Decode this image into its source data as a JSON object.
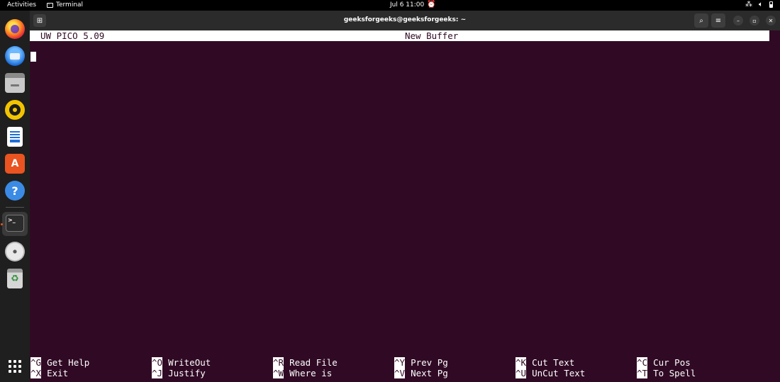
{
  "topbar": {
    "activities": "Activities",
    "app_name": "Terminal",
    "clock": "Jul 6  11:00"
  },
  "dock": {
    "items": [
      {
        "name": "Firefox",
        "icon": "firefox-icon"
      },
      {
        "name": "Thunderbird",
        "icon": "thunderbird-icon"
      },
      {
        "name": "Files",
        "icon": "files-icon"
      },
      {
        "name": "Rhythmbox",
        "icon": "rhythmbox-icon"
      },
      {
        "name": "LibreOffice Writer",
        "icon": "writer-icon"
      },
      {
        "name": "Ubuntu Software",
        "icon": "software-icon"
      },
      {
        "name": "Help",
        "icon": "help-icon",
        "glyph": "?"
      },
      {
        "name": "Terminal",
        "icon": "terminal-icon",
        "glyph": ">_"
      },
      {
        "name": "Disc",
        "icon": "disc-icon"
      },
      {
        "name": "Trash",
        "icon": "trash-icon",
        "glyph": "♻"
      },
      {
        "name": "Show Applications",
        "icon": "app-grid-icon"
      }
    ]
  },
  "window": {
    "title": "geeksforgeeks@geeksforgeeks: ~",
    "menu_glyph": "≡",
    "minimize_glyph": "–",
    "maximize_glyph": "▫",
    "close_glyph": "✕"
  },
  "pico": {
    "version": "UW PICO 5.09",
    "buffer": "New Buffer",
    "shortcuts": [
      {
        "key": "^G",
        "label": "Get Help"
      },
      {
        "key": "^X",
        "label": "Exit"
      },
      {
        "key": "^O",
        "label": "WriteOut"
      },
      {
        "key": "^J",
        "label": "Justify"
      },
      {
        "key": "^R",
        "label": "Read File"
      },
      {
        "key": "^W",
        "label": "Where is"
      },
      {
        "key": "^Y",
        "label": "Prev Pg"
      },
      {
        "key": "^V",
        "label": "Next Pg"
      },
      {
        "key": "^K",
        "label": "Cut Text"
      },
      {
        "key": "^U",
        "label": "UnCut Text"
      },
      {
        "key": "^C",
        "label": "Cur Pos"
      },
      {
        "key": "^T",
        "label": "To Spell"
      }
    ]
  },
  "colors": {
    "terminal_bg": "#300a24",
    "accent": "#e95420"
  }
}
